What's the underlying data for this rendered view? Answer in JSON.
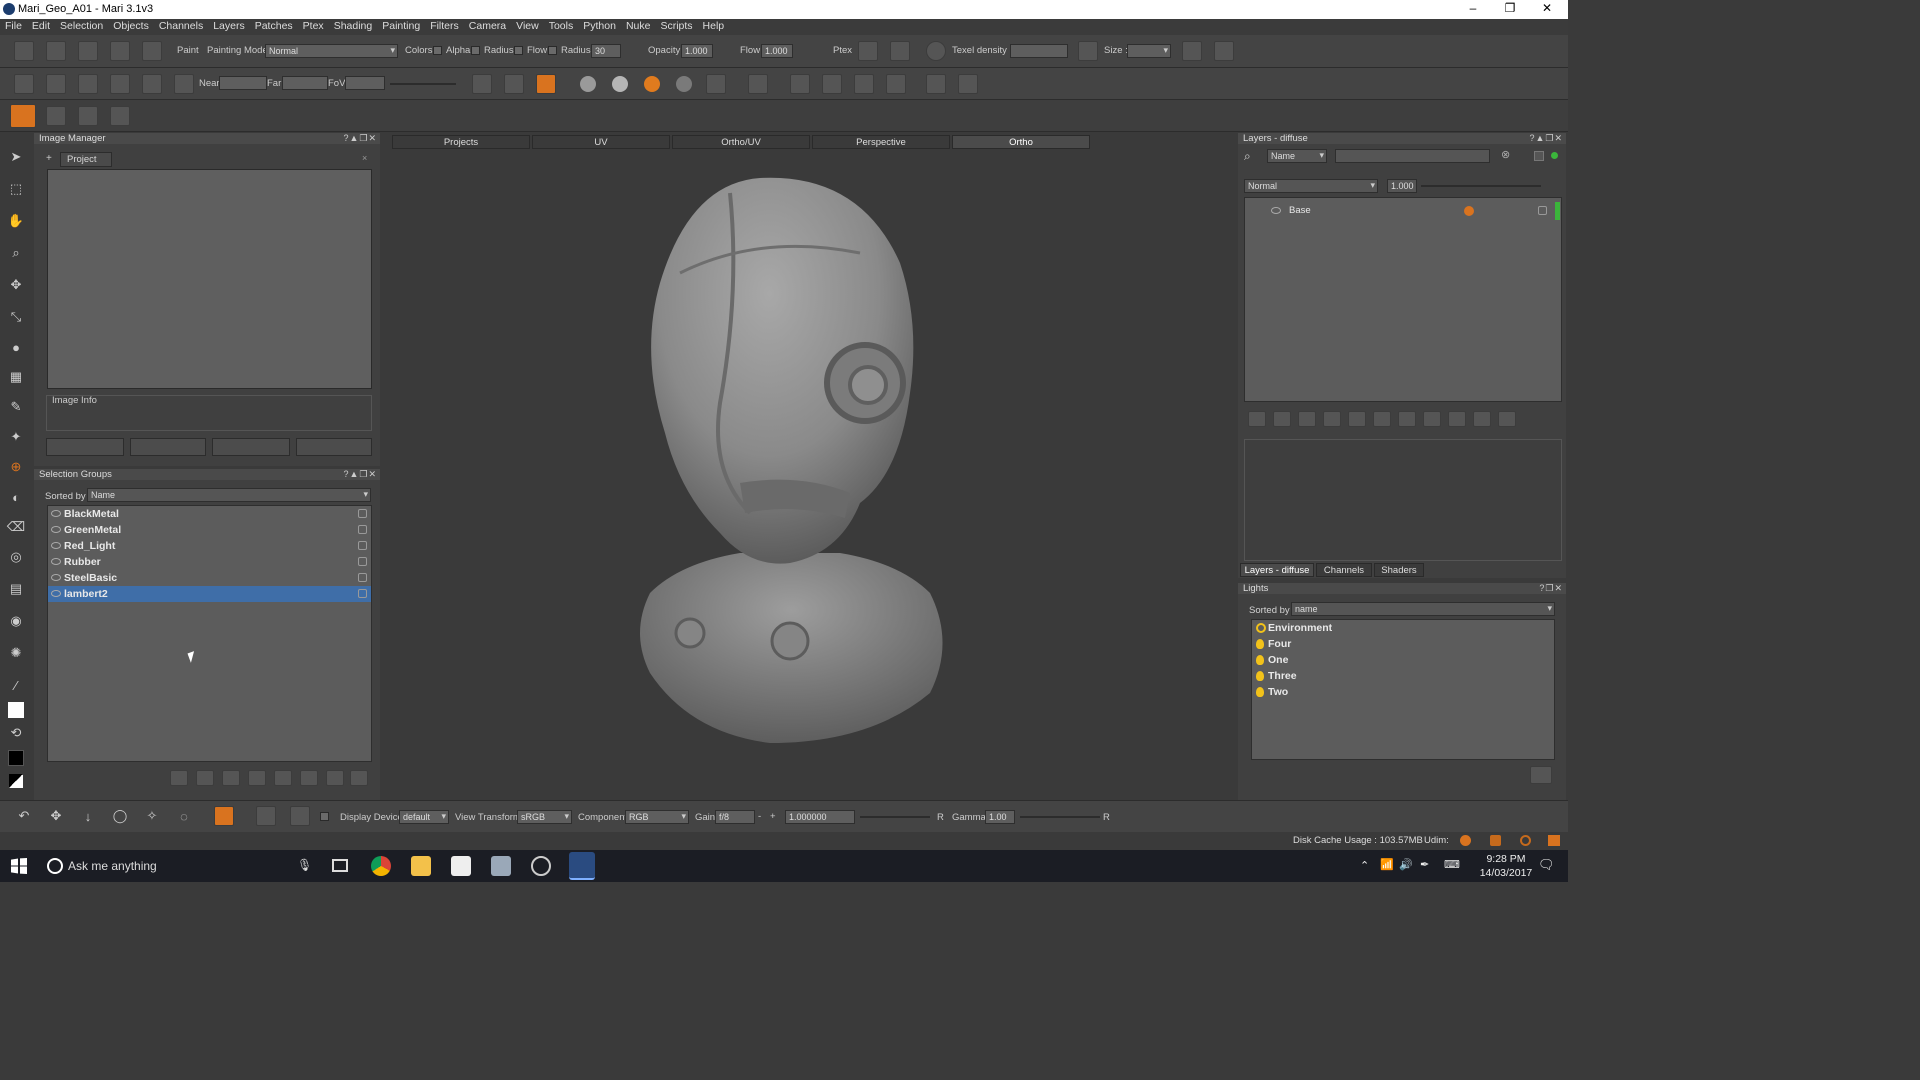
{
  "window": {
    "title": "Mari_Geo_A01 - Mari 3.1v3",
    "min": "–",
    "max": "❐",
    "close": "✕"
  },
  "menu": [
    "File",
    "Edit",
    "Selection",
    "Objects",
    "Channels",
    "Layers",
    "Patches",
    "Ptex",
    "Shading",
    "Painting",
    "Filters",
    "Camera",
    "View",
    "Tools",
    "Python",
    "Nuke",
    "Scripts",
    "Help"
  ],
  "toolbar1": {
    "paint": "Paint",
    "painting_mode_label": "Painting Mode",
    "painting_mode": "Normal",
    "colors": "Colors",
    "alpha": "Alpha",
    "radius_chk": "Radius",
    "flow_chk": "Flow",
    "radius_label": "Radius",
    "radius": "30",
    "opacity_label": "Opacity",
    "opacity": "1.000",
    "flow_label": "Flow",
    "flow": "1.000",
    "ptex": "Ptex",
    "texel_label": "Texel density :",
    "size_label": "Size :"
  },
  "toolbar2": {
    "near": "Near",
    "far": "Far",
    "fov": "FoV"
  },
  "image_manager": {
    "title": "Image Manager",
    "tab": "Project",
    "info": "Image Info"
  },
  "selection_groups": {
    "title": "Selection Groups",
    "sorted_by": "Sorted by",
    "sort": "Name",
    "items": [
      "BlackMetal",
      "GreenMetal",
      "Red_Light",
      "Rubber",
      "SteelBasic",
      "lambert2"
    ]
  },
  "viewport": {
    "tabs": [
      "Projects",
      "UV",
      "Ortho/UV",
      "Perspective",
      "Ortho"
    ]
  },
  "layers": {
    "title": "Layers - diffuse",
    "filter": "Name",
    "blend": "Normal",
    "opacity": "1.000",
    "base": "Base",
    "tabs": [
      "Layers - diffuse",
      "Channels",
      "Shaders"
    ]
  },
  "lights": {
    "title": "Lights",
    "sorted_by": "Sorted by",
    "sort": "name",
    "items": [
      "Environment",
      "Four",
      "One",
      "Three",
      "Two"
    ]
  },
  "bottombar": {
    "display_device_label": "Display Device",
    "display_device": "default",
    "view_transform_label": "View Transform",
    "view_transform": "sRGB",
    "component_label": "Component",
    "component": "RGB",
    "gain_label": "Gain",
    "gain": "f/8",
    "gain_value": "1.000000",
    "r1": "R",
    "gamma_label": "Gamma",
    "gamma": "1.00",
    "r2": "R"
  },
  "status": {
    "disk_cache": "Disk Cache Usage : 103.57MB",
    "udim": "Udim:"
  },
  "taskbar": {
    "search": "Ask me anything",
    "time": "9:28 PM",
    "date": "14/03/2017"
  },
  "colors": {
    "accent": "#d9731f",
    "selection": "#3f6ea8",
    "light": "#f2c21a"
  }
}
